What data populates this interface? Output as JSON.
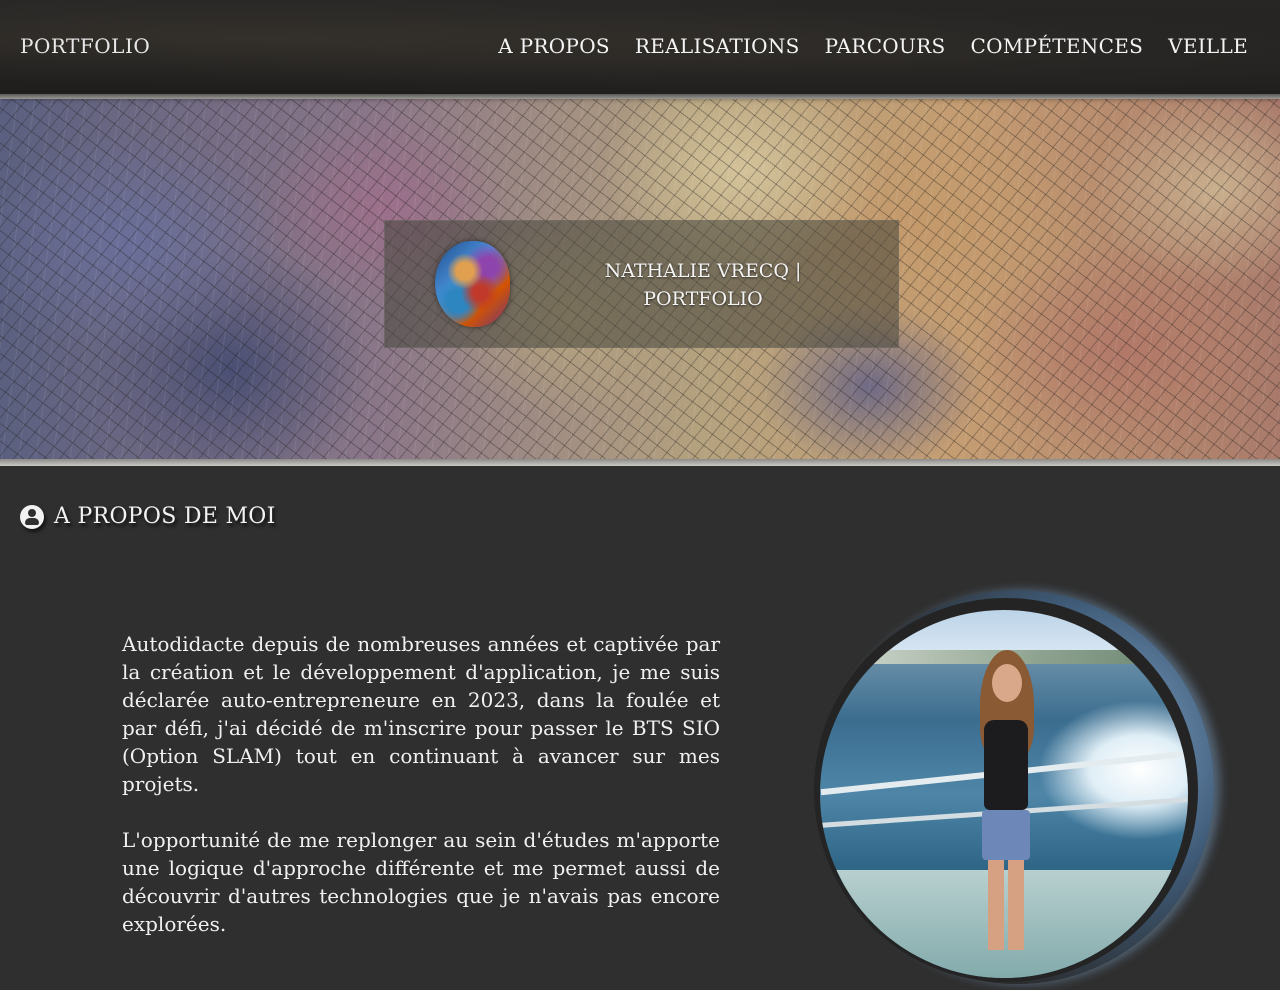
{
  "nav": {
    "brand": "PORTFOLIO",
    "links": [
      "A PROPOS",
      "REALISATIONS",
      "PARCOURS",
      "COMPÉTENCES",
      "VEILLE"
    ]
  },
  "hero": {
    "title_line1": "NATHALIE VRECQ |",
    "title_line2": "PORTFOLIO",
    "logo_icon": "mosaic-logo-icon"
  },
  "about": {
    "icon": "user-circle-icon",
    "heading": "A PROPOS DE MOI",
    "paragraphs": [
      "Autodidacte depuis de nombreuses années et captivée par la création et le développement d'application, je me suis déclarée auto-entrepreneure en 2023, dans la foulée et par défi, j'ai décidé de m'inscrire pour passer le BTS SIO (Option SLAM) tout en continuant à avancer sur mes projets.",
      "L'opportunité de me replonger au sein d'études m'apporte une logique d'approche différente et me permet aussi de découvrir d'autres technologies que je n'avais pas encore explorées."
    ]
  },
  "colors": {
    "page_bg": "#2f2f2f",
    "nav_bg": "#1f1e1d",
    "text": "#f2f2f2",
    "ring_accent": "#8ab0d4"
  }
}
